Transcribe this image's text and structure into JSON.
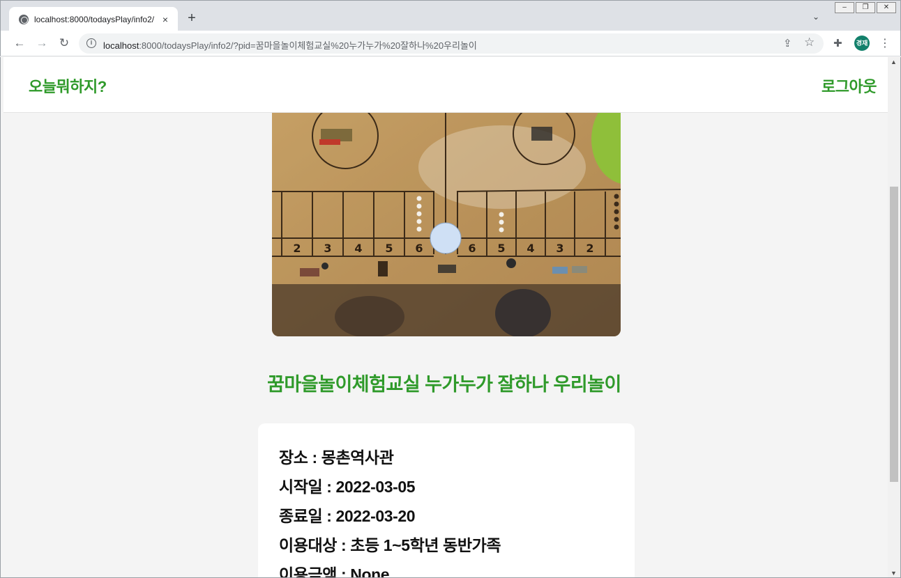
{
  "browser": {
    "tab_title": "localhost:8000/todaysPlay/info2/",
    "tab_close": "×",
    "new_tab": "+",
    "tab_menu": "⌄",
    "url_host": "localhost",
    "url_rest": ":8000/todaysPlay/info2/?pid=꿈마을놀이체험교실%20누가누가%20잘하나%20우리놀이",
    "profile_initials": "경재"
  },
  "site": {
    "brand": "오늘뭐하지?",
    "logout": "로그아웃",
    "accent_color": "#2f9a2a"
  },
  "play": {
    "title": "꿈마을놀이체험교실 누가누가 잘하나 우리놀이",
    "board_numbers_left": [
      "2",
      "3",
      "4",
      "5",
      "6"
    ],
    "board_numbers_right": [
      "6",
      "5",
      "4",
      "3",
      "2"
    ],
    "details": [
      "장소 : 몽촌역사관",
      "시작일 : 2022-03-05",
      "종료일 : 2022-03-20",
      "이용대상 : 초등 1~5학년 동반가족",
      "이용금액 : None"
    ]
  }
}
